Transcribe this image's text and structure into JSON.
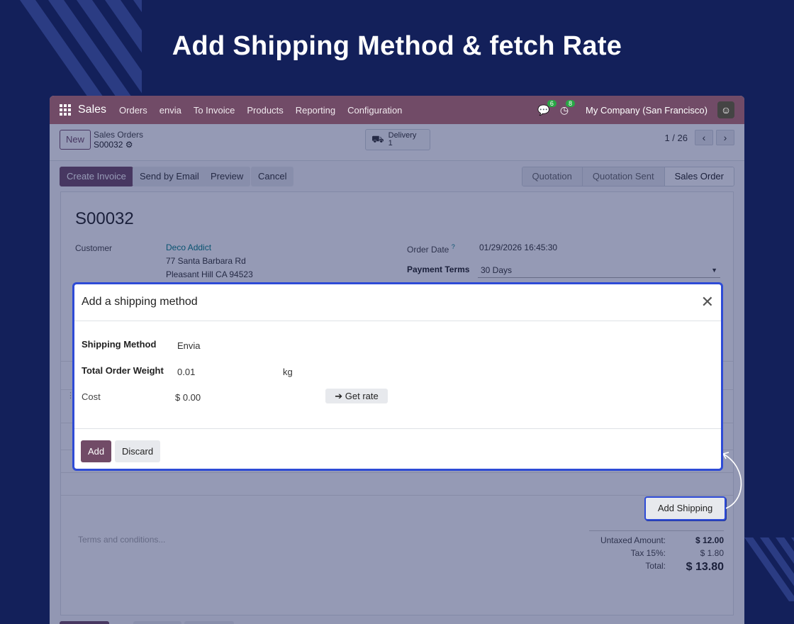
{
  "headline": "Add Shipping Method & fetch Rate",
  "navbar": {
    "brand": "Sales",
    "items": [
      "Orders",
      "envia",
      "To Invoice",
      "Products",
      "Reporting",
      "Configuration"
    ],
    "messages_count": "6",
    "activities_count": "8",
    "company": "My Company (San Francisco)"
  },
  "control_panel": {
    "new_label": "New",
    "breadcrumb_parent": "Sales Orders",
    "breadcrumb_record": "S00032",
    "delivery_label": "Delivery",
    "delivery_count": "1",
    "pager": "1 / 26"
  },
  "statusbar": {
    "buttons": [
      "Create Invoice",
      "Send by Email",
      "Preview",
      "Cancel"
    ],
    "stages": [
      "Quotation",
      "Quotation Sent",
      "Sales Order"
    ],
    "active_stage": "Sales Order"
  },
  "form": {
    "name": "S00032",
    "customer_label": "Customer",
    "customer_name": "Deco Addict",
    "customer_address_1": "77 Santa Barbara Rd",
    "customer_address_2": "Pleasant Hill CA 94523",
    "order_date_label": "Order Date",
    "order_date_help": "?",
    "order_date": "01/29/2026 16:45:30",
    "payment_terms_label": "Payment Terms",
    "payment_terms": "30 Days",
    "add_shipping_label": "Add Shipping",
    "terms_placeholder": "Terms and conditions...",
    "untaxed_label": "Untaxed Amount:",
    "untaxed_value": "$ 12.00",
    "tax_label": "Tax 15%:",
    "tax_value": "$ 1.80",
    "total_label": "Total:",
    "total_value": "$ 13.80"
  },
  "modal": {
    "title": "Add a shipping method",
    "shipping_method_label": "Shipping Method",
    "shipping_method_value": "Envia",
    "weight_label": "Total Order Weight",
    "weight_value": "0.01",
    "weight_unit": "kg",
    "cost_label": "Cost",
    "cost_value": "$ 0.00",
    "get_rate_label": "➔ Get rate",
    "add_label": "Add",
    "discard_label": "Discard"
  },
  "colors": {
    "brand_purple": "#714b67",
    "highlight_blue": "#2e4bd6",
    "background_navy": "#13205a"
  }
}
